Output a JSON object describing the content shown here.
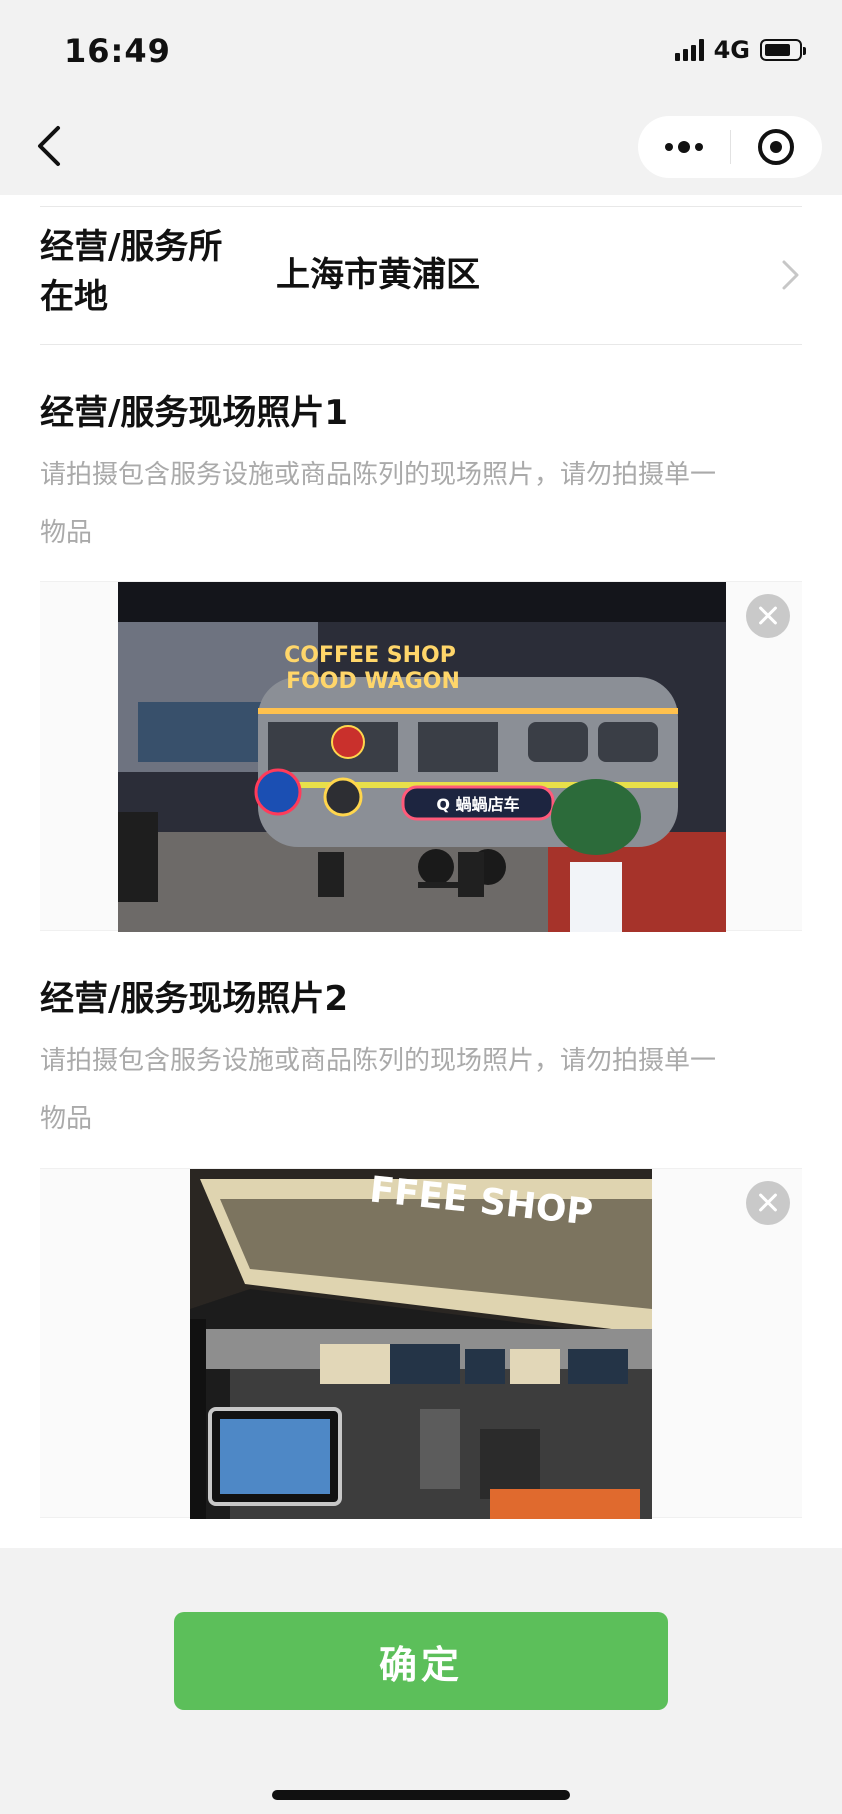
{
  "status_bar": {
    "time": "16:49",
    "network": "4G"
  },
  "location": {
    "label_line1": "经营/服务所",
    "label_line2": "在地",
    "value": "上海市黄浦区"
  },
  "photo_section_1": {
    "title": "经营/服务现场照片1",
    "desc_line1": "请拍摄包含服务设施或商品陈列的现场照片，请勿拍摄单一",
    "desc_line2": "物品",
    "sign_line1": "COFFEE SHOP",
    "sign_line2": "FOOD WAGON",
    "shop_sign": "Q 蝸蝸店车"
  },
  "photo_section_2": {
    "title": "经营/服务现场照片2",
    "desc_line1": "请拍摄包含服务设施或商品陈列的现场照片，请勿拍摄单一",
    "desc_line2": "物品",
    "sign_text": "FFEE SHOP"
  },
  "confirm_button": {
    "label": "确定"
  },
  "colors": {
    "accent": "#5cbf5a",
    "hint_text": "#aaaaaa",
    "chrome_bg": "#f2f2f2"
  }
}
